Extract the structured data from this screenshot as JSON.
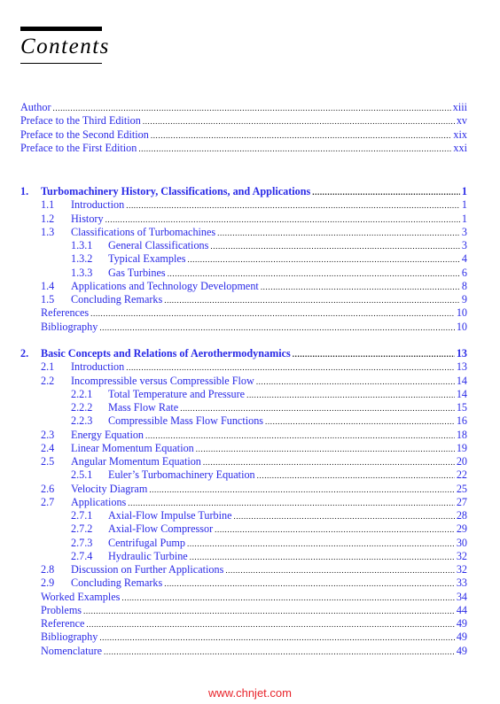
{
  "heading": "Contents",
  "front_matter": [
    {
      "label": "Author",
      "page": "xiii"
    },
    {
      "label": "Preface to the Third Edition",
      "page": "xv"
    },
    {
      "label": "Preface to the Second Edition",
      "page": "xix"
    },
    {
      "label": "Preface to the First Edition",
      "page": "xxi"
    }
  ],
  "chapters": [
    {
      "number": "1.",
      "title": "Turbomachinery History, Classifications, and Applications",
      "page": "1",
      "entries": [
        {
          "level": 1,
          "number": "1.1",
          "label": "Introduction",
          "page": "1"
        },
        {
          "level": 1,
          "number": "1.2",
          "label": "History",
          "page": "1"
        },
        {
          "level": 1,
          "number": "1.3",
          "label": "Classifications of Turbomachines",
          "page": "3"
        },
        {
          "level": 2,
          "number": "1.3.1",
          "label": "General Classifications",
          "page": "3"
        },
        {
          "level": 2,
          "number": "1.3.2",
          "label": "Typical Examples",
          "page": "4"
        },
        {
          "level": 2,
          "number": "1.3.3",
          "label": "Gas Turbines",
          "page": "6"
        },
        {
          "level": 1,
          "number": "1.4",
          "label": "Applications and Technology Development",
          "page": "8"
        },
        {
          "level": 1,
          "number": "1.5",
          "label": "Concluding Remarks",
          "page": "9"
        },
        {
          "level": 0,
          "number": "",
          "label": "References",
          "page": "10"
        },
        {
          "level": 0,
          "number": "",
          "label": "Bibliography",
          "page": "10"
        }
      ]
    },
    {
      "number": "2.",
      "title": "Basic Concepts and Relations of Aerothermodynamics",
      "page": "13",
      "entries": [
        {
          "level": 1,
          "number": "2.1",
          "label": "Introduction",
          "page": "13"
        },
        {
          "level": 1,
          "number": "2.2",
          "label": "Incompressible versus Compressible Flow",
          "page": "14"
        },
        {
          "level": 2,
          "number": "2.2.1",
          "label": "Total Temperature and Pressure",
          "page": "14"
        },
        {
          "level": 2,
          "number": "2.2.2",
          "label": "Mass Flow Rate",
          "page": "15"
        },
        {
          "level": 2,
          "number": "2.2.3",
          "label": "Compressible Mass Flow Functions",
          "page": "16"
        },
        {
          "level": 1,
          "number": "2.3",
          "label": "Energy Equation",
          "page": "18"
        },
        {
          "level": 1,
          "number": "2.4",
          "label": "Linear Momentum Equation",
          "page": "19"
        },
        {
          "level": 1,
          "number": "2.5",
          "label": "Angular Momentum Equation",
          "page": "20"
        },
        {
          "level": 2,
          "number": "2.5.1",
          "label": "Euler’s Turbomachinery Equation",
          "page": "22"
        },
        {
          "level": 1,
          "number": "2.6",
          "label": "Velocity Diagram",
          "page": "25"
        },
        {
          "level": 1,
          "number": "2.7",
          "label": "Applications",
          "page": "27"
        },
        {
          "level": 2,
          "number": "2.7.1",
          "label": "Axial-Flow Impulse Turbine",
          "page": "28"
        },
        {
          "level": 2,
          "number": "2.7.2",
          "label": "Axial-Flow Compressor",
          "page": "29"
        },
        {
          "level": 2,
          "number": "2.7.3",
          "label": "Centrifugal Pump",
          "page": "30"
        },
        {
          "level": 2,
          "number": "2.7.4",
          "label": "Hydraulic Turbine",
          "page": "32"
        },
        {
          "level": 1,
          "number": "2.8",
          "label": "Discussion on Further Applications",
          "page": "32"
        },
        {
          "level": 1,
          "number": "2.9",
          "label": "Concluding Remarks",
          "page": "33"
        },
        {
          "level": 0,
          "number": "",
          "label": "Worked Examples",
          "page": "34"
        },
        {
          "level": 0,
          "number": "",
          "label": "Problems",
          "page": "44"
        },
        {
          "level": 0,
          "number": "",
          "label": "Reference",
          "page": "49"
        },
        {
          "level": 0,
          "number": "",
          "label": "Bibliography",
          "page": "49"
        },
        {
          "level": 0,
          "number": "",
          "label": "Nomenclature",
          "page": "49"
        }
      ]
    }
  ],
  "watermark": "www.chnjet.com",
  "colors": {
    "link": "#2a2ae6",
    "text": "#000000",
    "watermark": "#e8242b"
  }
}
